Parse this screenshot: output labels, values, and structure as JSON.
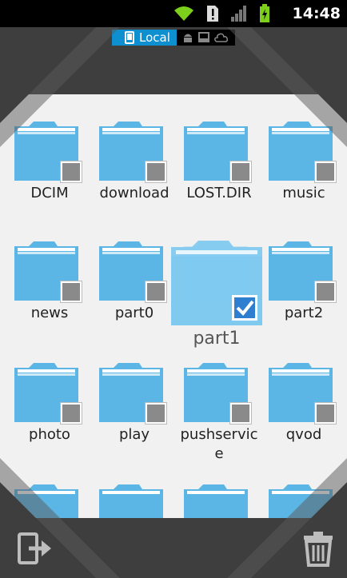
{
  "status": {
    "time": "14:48"
  },
  "location": {
    "active_label": "Local"
  },
  "folders": [
    {
      "name": "DCIM"
    },
    {
      "name": "download"
    },
    {
      "name": "LOST.DIR"
    },
    {
      "name": "music"
    },
    {
      "name": "news"
    },
    {
      "name": "part0"
    },
    {
      "name": "part1"
    },
    {
      "name": "part2"
    },
    {
      "name": "photo"
    },
    {
      "name": "play"
    },
    {
      "name": "pushservice"
    },
    {
      "name": "qvod"
    }
  ],
  "labels_split": {
    "pushservice_line1": "pushservic",
    "pushservice_line2": "e"
  },
  "icons": {
    "top_left": "share-icon",
    "top_right": "copy-icon",
    "bottom_left": "move-icon",
    "bottom_right": "trash-icon"
  },
  "colors": {
    "accent": "#0d8fd0",
    "folder": "#5bb6e6",
    "checked": "#2f7fd1"
  }
}
